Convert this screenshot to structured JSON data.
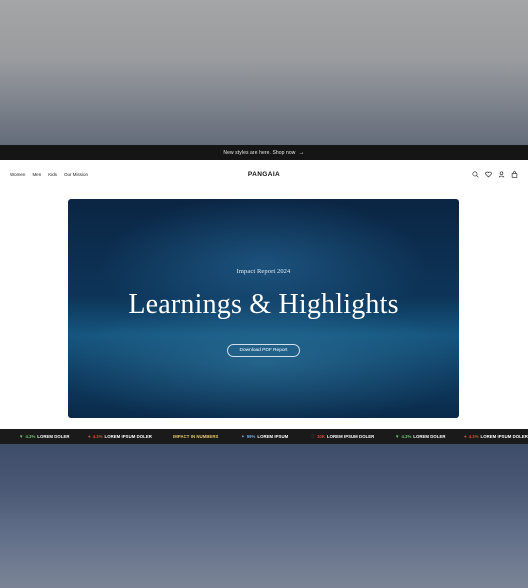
{
  "announcement": {
    "text": "New styles are here. Shop now",
    "arrow": "→"
  },
  "nav": {
    "links": [
      "Women",
      "Men",
      "Kids",
      "Our Mission"
    ],
    "logo": "PANGAIA",
    "icons": [
      "search-icon",
      "heart-icon",
      "user-icon",
      "bag-icon"
    ]
  },
  "hero": {
    "eyebrow": "Impact Report 2024",
    "title": "Learnings & Highlights",
    "cta": "Download PDF Report"
  },
  "ticker": {
    "items": [
      {
        "symbol": "▼",
        "symbol_color": "#6fbf73",
        "value": "4.3%",
        "value_color": "#6fbf73",
        "label": "LOREM DOLER",
        "label_color": "#ffffff"
      },
      {
        "symbol": "●",
        "symbol_color": "#e04b3a",
        "value": "4.3%",
        "value_color": "#e04b3a",
        "label": "LOREM IPSUM DOLER",
        "label_color": "#ffffff"
      },
      {
        "symbol": "",
        "symbol_color": "#ffffff",
        "value": "",
        "value_color": "#ffffff",
        "label": "IMPACT IN NUMBERS",
        "label_color": "#e8c86a"
      },
      {
        "symbol": "✦",
        "symbol_color": "#6fa8dc",
        "value": "99%",
        "value_color": "#6fa8dc",
        "label": "LOREM IPSUM",
        "label_color": "#ffffff"
      },
      {
        "symbol": "♡",
        "symbol_color": "#e04b3a",
        "value": "10K",
        "value_color": "#e04b3a",
        "label": "LOREM IPSUM DOLER",
        "label_color": "#ffffff"
      },
      {
        "symbol": "▼",
        "symbol_color": "#6fbf73",
        "value": "4.3%",
        "value_color": "#6fbf73",
        "label": "LOREM DOLER",
        "label_color": "#ffffff"
      },
      {
        "symbol": "●",
        "symbol_color": "#e04b3a",
        "value": "4.3%",
        "value_color": "#e04b3a",
        "label": "LOREM IPSUM DOLER",
        "label_color": "#ffffff"
      }
    ]
  }
}
